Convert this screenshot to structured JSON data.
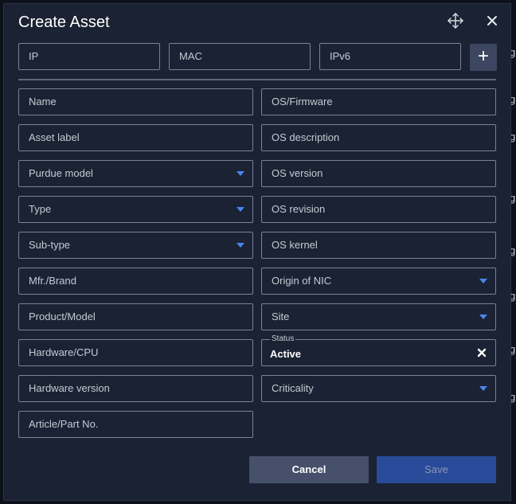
{
  "dialog": {
    "title": "Create Asset",
    "icons": {
      "move": "move-arrows-icon",
      "close": "close-icon"
    }
  },
  "addresses": {
    "ip_placeholder": "IP",
    "mac_placeholder": "MAC",
    "ipv6_placeholder": "IPv6",
    "add_label": "+"
  },
  "fields": {
    "name": "Name",
    "asset_label": "Asset label",
    "purdue_model": "Purdue model",
    "type": "Type",
    "sub_type": "Sub-type",
    "mfr_brand": "Mfr./Brand",
    "product_model": "Product/Model",
    "hardware_cpu": "Hardware/CPU",
    "hardware_version": "Hardware version",
    "article_part_no": "Article/Part No.",
    "os_firmware": "OS/Firmware",
    "os_description": "OS description",
    "os_version": "OS version",
    "os_revision": "OS revision",
    "os_kernel": "OS kernel",
    "origin_of_nic": "Origin of NIC",
    "site": "Site",
    "criticality": "Criticality"
  },
  "status": {
    "legend": "Status",
    "value": "Active"
  },
  "actions": {
    "cancel": "Cancel",
    "save": "Save"
  },
  "colors": {
    "dialog_bg": "#1b2233",
    "field_border": "#7a8296",
    "dropdown_caret": "#4a86f0",
    "cancel_bg": "#46506a",
    "save_bg": "#2a4a9a"
  }
}
